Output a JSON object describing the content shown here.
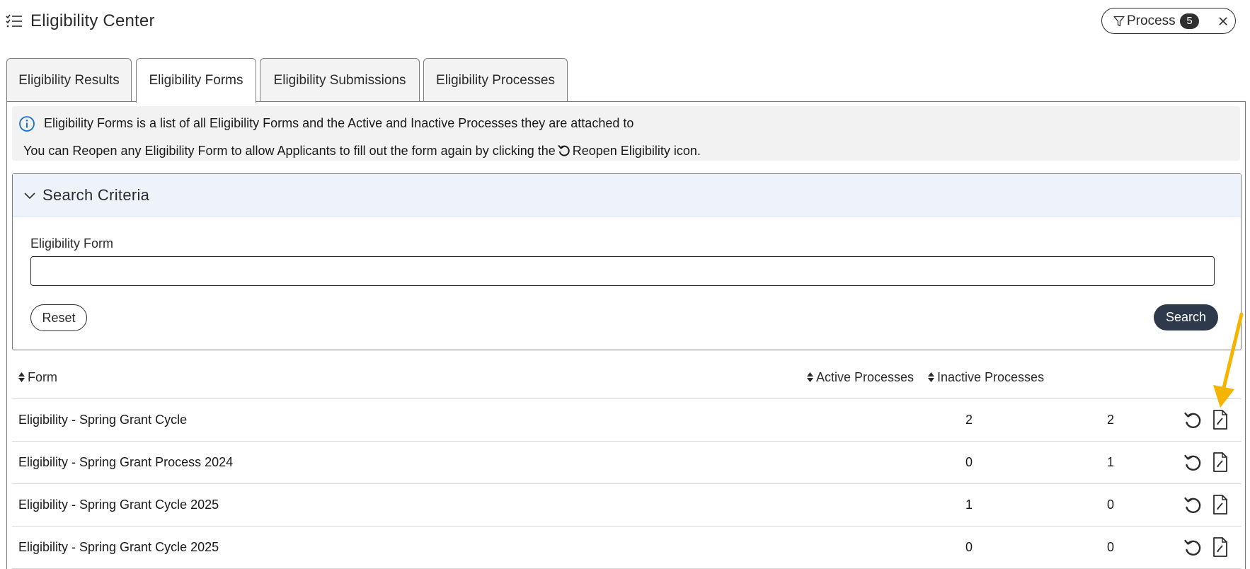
{
  "header": {
    "title": "Eligibility Center",
    "filter_label": "Process",
    "filter_count": "5"
  },
  "tabs": [
    {
      "label": "Eligibility Results",
      "active": false
    },
    {
      "label": "Eligibility Forms",
      "active": true
    },
    {
      "label": "Eligibility Submissions",
      "active": false
    },
    {
      "label": "Eligibility Processes",
      "active": false
    }
  ],
  "info": {
    "line1": "Eligibility Forms is a list of all Eligibility Forms and the Active and Inactive Processes they are attached to",
    "line2_before": "You can Reopen any Eligibility Form to allow Applicants to fill out the form again by clicking the",
    "line2_after": "Reopen Eligibility icon."
  },
  "search": {
    "title": "Search Criteria",
    "field_label": "Eligibility Form",
    "field_value": "",
    "reset_label": "Reset",
    "search_label": "Search"
  },
  "table": {
    "columns": [
      "Form",
      "Active Processes",
      "Inactive Processes"
    ],
    "rows": [
      {
        "form": "Eligibility - Spring Grant Cycle",
        "active": "2",
        "inactive": "2"
      },
      {
        "form": "Eligibility - Spring Grant Process 2024",
        "active": "0",
        "inactive": "1"
      },
      {
        "form": "Eligibility - Spring Grant Cycle 2025",
        "active": "1",
        "inactive": "0"
      },
      {
        "form": "Eligibility - Spring Grant Cycle 2025",
        "active": "0",
        "inactive": "0"
      }
    ]
  },
  "colors": {
    "accent_dark": "#2e3a4b",
    "info_blue": "#1a6fd1",
    "annotation_arrow": "#f5b400",
    "search_header_bg": "#eef3fb"
  },
  "icons": {
    "header": "list-check-icon",
    "filter": "funnel-icon",
    "close": "close-icon",
    "info": "info-circle-icon",
    "collapse": "chevron-down-icon",
    "sort": "sort-icon",
    "reopen": "reopen-icon",
    "document": "document-edit-icon"
  }
}
